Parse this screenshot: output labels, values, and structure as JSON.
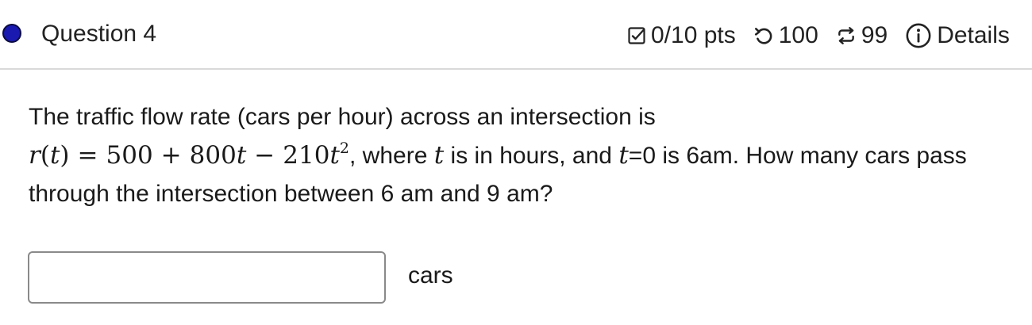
{
  "question": {
    "title": "Question 4",
    "score": "0/10 pts",
    "attempts": "100",
    "versions": "99",
    "details_label": "Details"
  },
  "body": {
    "intro": "The traffic flow rate (cars per hour) across an intersection is",
    "formula_lhs_func": "r",
    "formula_lhs_var": "t",
    "formula_eq": "=",
    "formula_c0": "500",
    "formula_plus": "+",
    "formula_c1": "800",
    "formula_var1": "t",
    "formula_minus": "−",
    "formula_c2": "210",
    "formula_var2": "t",
    "formula_exp": "2",
    "after_formula": ", where ",
    "var_t": "t",
    "mid_text": " is in hours, and ",
    "var_t2": "t",
    "t_zero": "=0 is 6am. How many cars pass through the intersection between 6 am and 9 am?"
  },
  "answer": {
    "value": "",
    "unit": "cars"
  },
  "colors": {
    "status_dot": "#1a1ab0",
    "divider": "#d9d9d9"
  },
  "icons": {
    "score": "checkbox-check-icon",
    "attempts": "undo-arrow-icon",
    "versions": "repeat-arrows-icon",
    "details": "info-circle-icon"
  }
}
